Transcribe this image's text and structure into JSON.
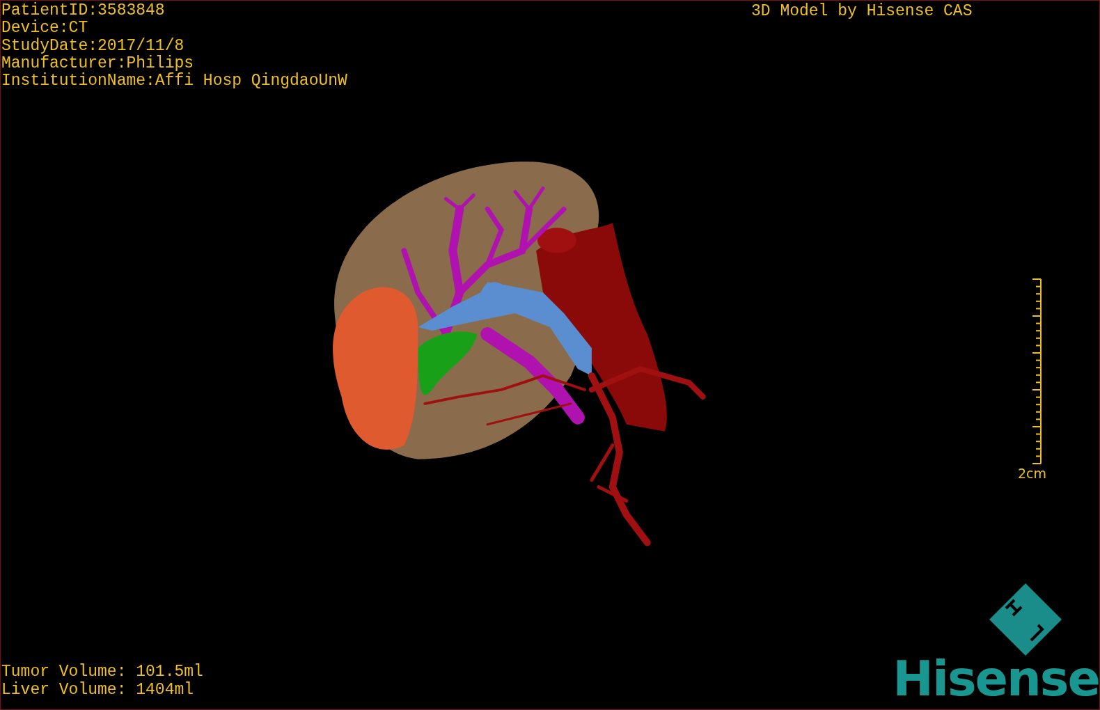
{
  "viewer": {
    "patient_info": [
      "PatientID:3583848",
      "Device:CT",
      "StudyDate:2017/11/8",
      "Manufacturer:Philips",
      "InstitutionName:Affi Hosp QingdaoUnW"
    ],
    "credit": "3D Model by Hisense CAS",
    "scale_bar": {
      "label": "2cm"
    },
    "volumes": [
      "Tumor Volume: 101.5ml",
      "Liver Volume: 1404ml"
    ],
    "logo": {
      "text": "Hisense"
    }
  }
}
